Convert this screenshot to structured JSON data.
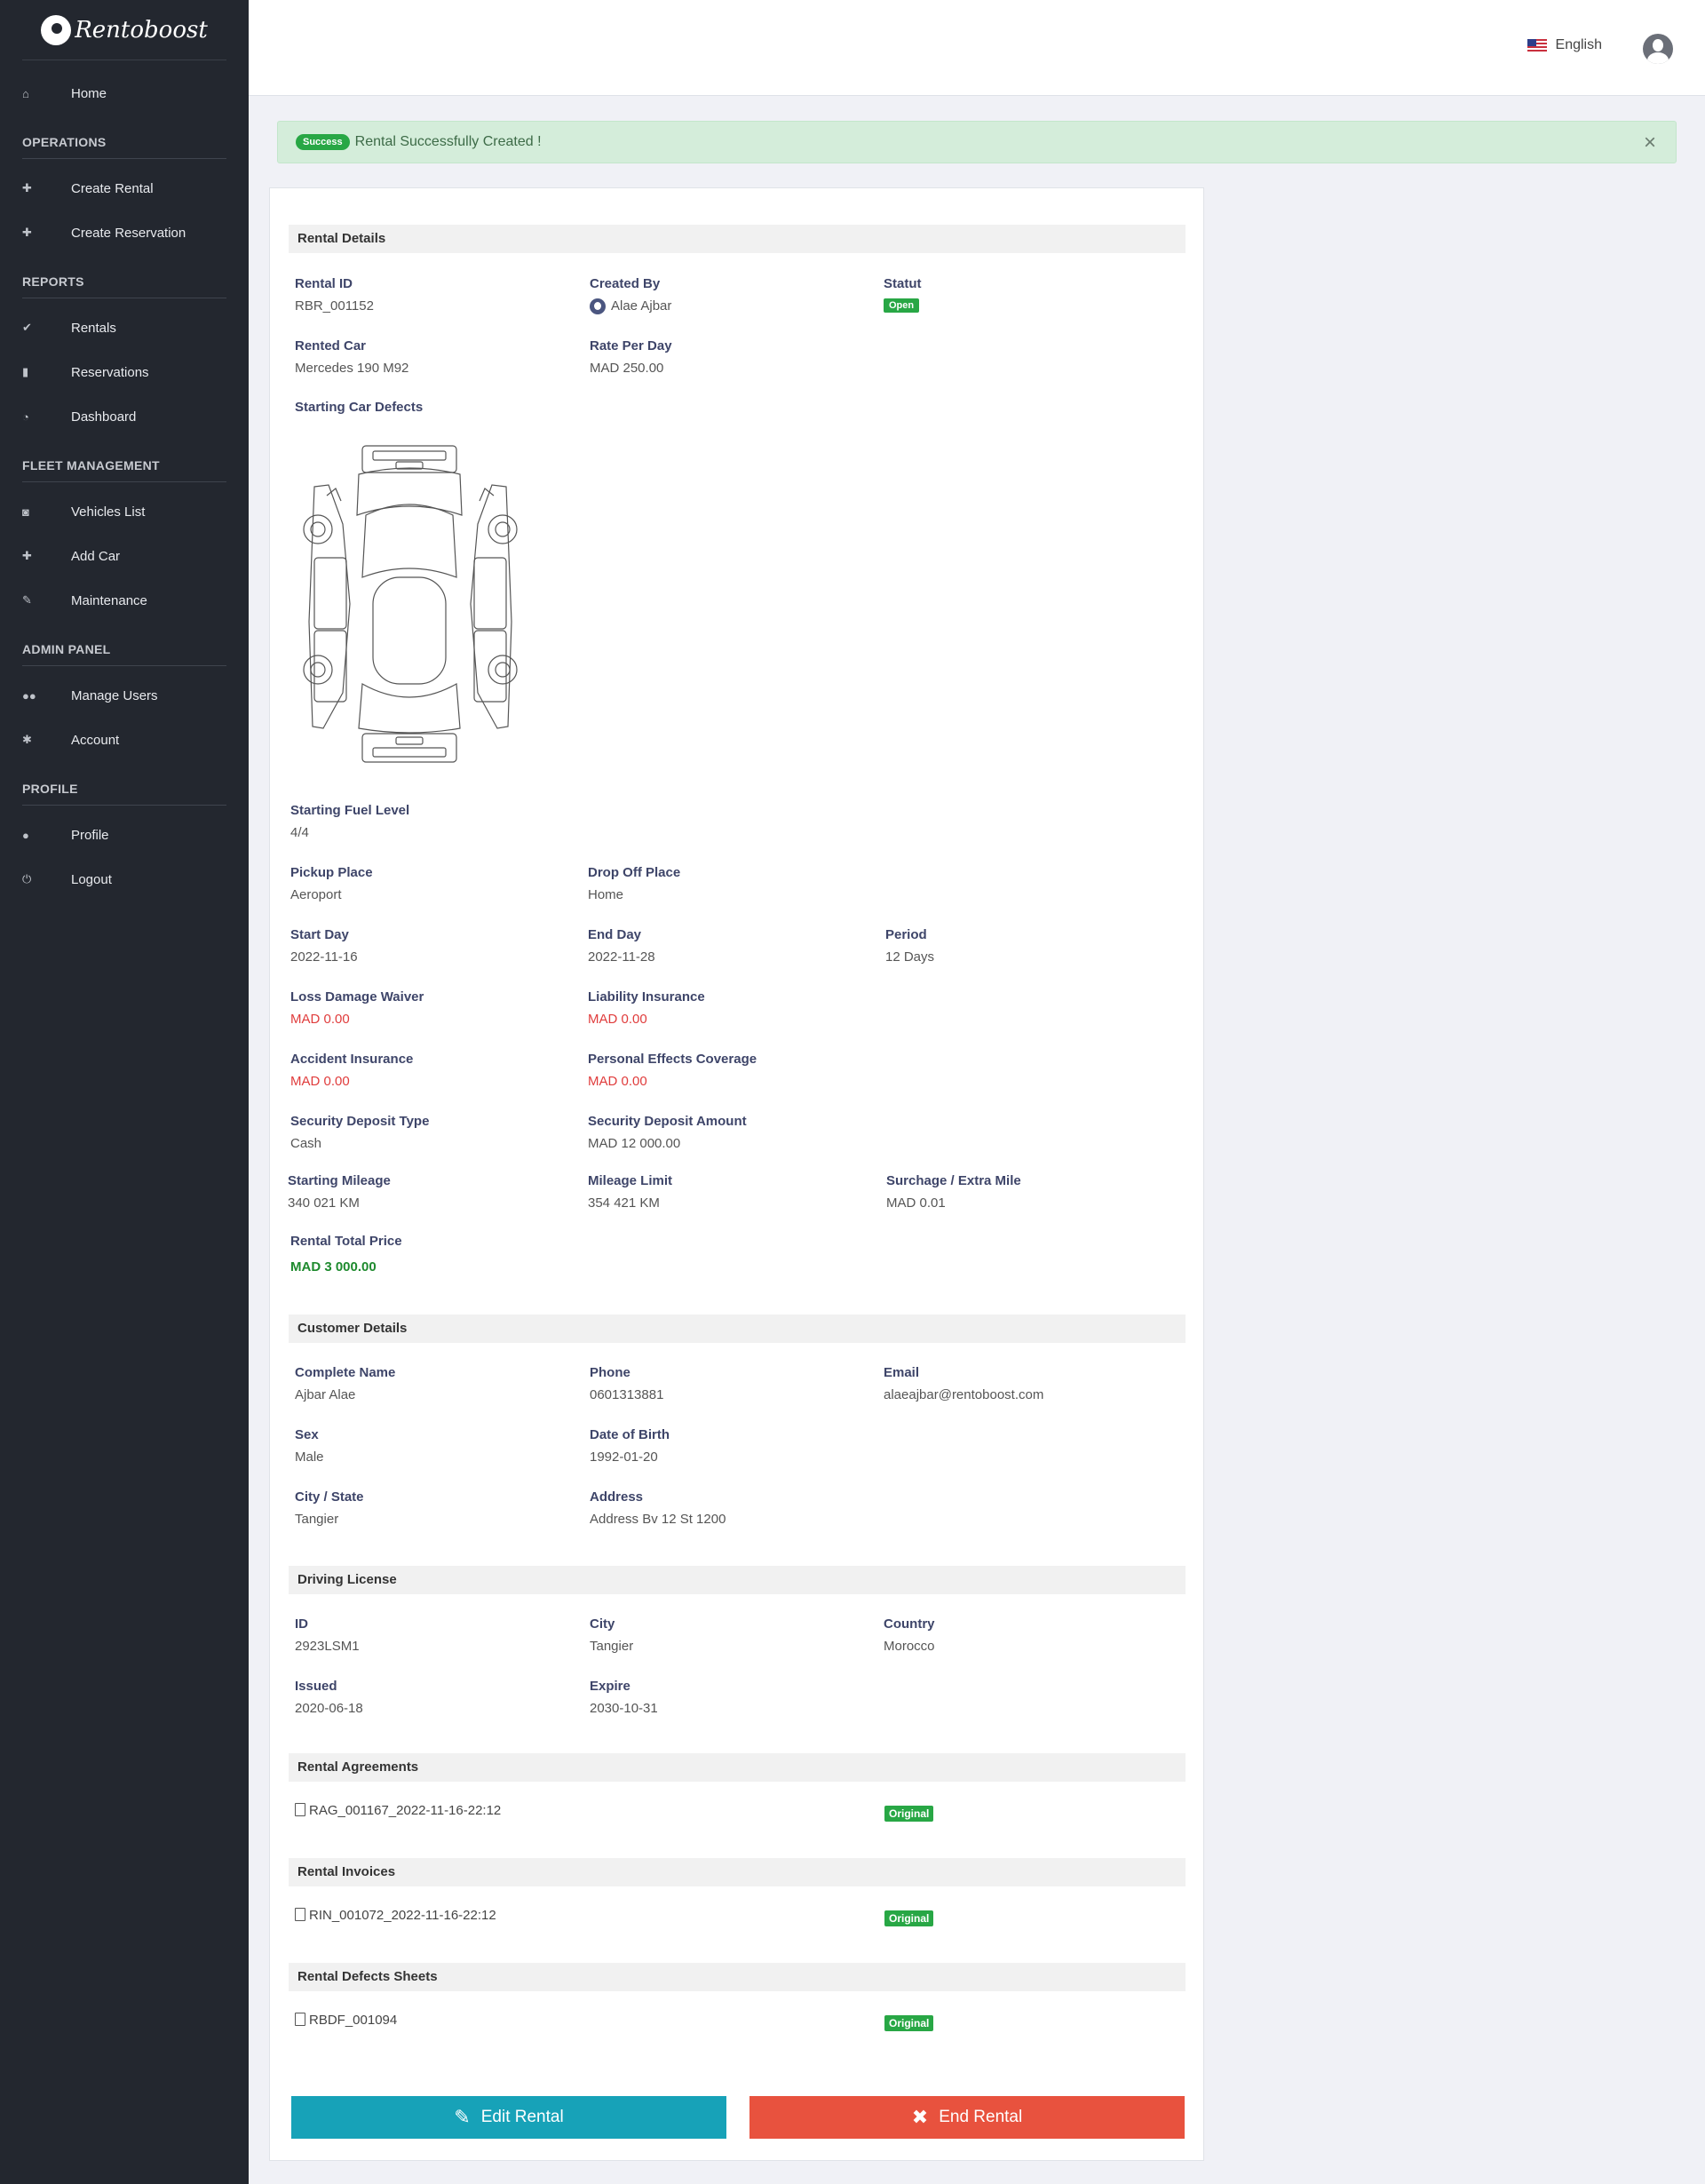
{
  "brand": "Rentoboost",
  "sidebar": {
    "home": "Home",
    "sections": {
      "operations": "OPERATIONS",
      "reports": "REPORTS",
      "fleet": "FLEET MANAGEMENT",
      "admin": "ADMIN PANEL",
      "profile": "PROFILE"
    },
    "items": {
      "create_rental": "Create Rental",
      "create_reservation": "Create Reservation",
      "rentals": "Rentals",
      "reservations": "Reservations",
      "dashboard": "Dashboard",
      "vehicles_list": "Vehicles List",
      "add_car": "Add Car",
      "maintenance": "Maintenance",
      "manage_users": "Manage Users",
      "account": "Account",
      "profile": "Profile",
      "logout": "Logout"
    }
  },
  "header": {
    "language": "English"
  },
  "alert": {
    "badge": "Success",
    "message": "Rental Successfully Created !",
    "close": "×"
  },
  "rental": {
    "section_title": "Rental Details",
    "rental_id": {
      "label": "Rental ID",
      "value": "RBR_001152"
    },
    "created_by": {
      "label": "Created By",
      "value": "Alae Ajbar"
    },
    "statut": {
      "label": "Statut",
      "value": "Open"
    },
    "rented_car": {
      "label": "Rented Car",
      "value": "Mercedes 190 M92"
    },
    "rate_per_day": {
      "label": "Rate Per Day",
      "value": "MAD 250.00"
    },
    "defects_label": "Starting Car Defects",
    "fuel": {
      "label": "Starting Fuel Level",
      "value": "4/4"
    },
    "pickup": {
      "label": "Pickup Place",
      "value": "Aeroport"
    },
    "dropoff": {
      "label": "Drop Off Place",
      "value": "Home"
    },
    "start_day": {
      "label": "Start Day",
      "value": "2022-11-16"
    },
    "end_day": {
      "label": "End Day",
      "value": "2022-11-28"
    },
    "period": {
      "label": "Period",
      "value": "12 Days"
    },
    "ldw": {
      "label": "Loss Damage Waiver",
      "value": "MAD 0.00"
    },
    "liability": {
      "label": "Liability Insurance",
      "value": "MAD 0.00"
    },
    "accident": {
      "label": "Accident Insurance",
      "value": "MAD 0.00"
    },
    "personal": {
      "label": "Personal Effects Coverage",
      "value": "MAD 0.00"
    },
    "deposit_type": {
      "label": "Security Deposit Type",
      "value": "Cash"
    },
    "deposit_amount": {
      "label": "Security Deposit Amount",
      "value": "MAD 12 000.00"
    },
    "start_mileage": {
      "label": "Starting Mileage",
      "value": "340 021 KM"
    },
    "mileage_limit": {
      "label": "Mileage Limit",
      "value": "354 421 KM"
    },
    "surcharge": {
      "label": "Surchage / Extra Mile",
      "value": "MAD 0.01"
    },
    "total": {
      "label": "Rental Total Price",
      "value": "MAD 3 000.00"
    }
  },
  "customer": {
    "section_title": "Customer Details",
    "name": {
      "label": "Complete Name",
      "value": "Ajbar Alae"
    },
    "phone": {
      "label": "Phone",
      "value": "0601313881"
    },
    "email": {
      "label": "Email",
      "value": "alaeajbar@rentoboost.com"
    },
    "sex": {
      "label": "Sex",
      "value": "Male"
    },
    "dob": {
      "label": "Date of Birth",
      "value": "1992-01-20"
    },
    "city": {
      "label": "City / State",
      "value": "Tangier"
    },
    "address": {
      "label": "Address",
      "value": "Address Bv 12 St 1200"
    }
  },
  "license": {
    "section_title": "Driving License",
    "id": {
      "label": "ID",
      "value": "2923LSM1"
    },
    "city": {
      "label": "City",
      "value": "Tangier"
    },
    "country": {
      "label": "Country",
      "value": "Morocco"
    },
    "issued": {
      "label": "Issued",
      "value": "2020-06-18"
    },
    "expire": {
      "label": "Expire",
      "value": "2030-10-31"
    }
  },
  "agreements": {
    "section_title": "Rental Agreements",
    "file": "RAG_001167_2022-11-16-22:12",
    "tag": "Original"
  },
  "invoices": {
    "section_title": "Rental Invoices",
    "file": "RIN_001072_2022-11-16-22:12",
    "tag": "Original"
  },
  "defects": {
    "section_title": "Rental Defects Sheets",
    "file": "RBDF_001094",
    "tag": "Original"
  },
  "actions": {
    "edit": "Edit Rental",
    "end": "End Rental"
  },
  "colors": {
    "sidebar": "#23272f",
    "success": "#28a745",
    "edit": "#17a2b8",
    "end": "#e8523e",
    "label": "#3e4569",
    "money_red": "#e03c3c",
    "money_green": "#1e8a2e"
  }
}
